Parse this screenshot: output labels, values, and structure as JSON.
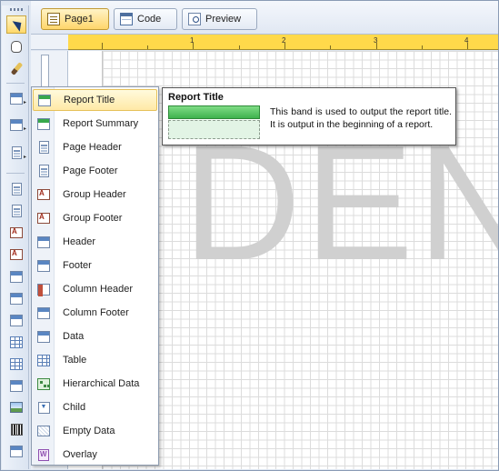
{
  "tabs": [
    {
      "label": "Page1",
      "icon": "page-icon",
      "active": true
    },
    {
      "label": "Code",
      "icon": "code-icon",
      "active": false
    },
    {
      "label": "Preview",
      "icon": "preview-icon",
      "active": false
    }
  ],
  "ruler": {
    "labels": [
      "1",
      "2",
      "3",
      "4"
    ]
  },
  "canvas": {
    "watermark": "DEN"
  },
  "menu": {
    "items": [
      {
        "label": "Report Title",
        "icon": "report-title-band-icon"
      },
      {
        "label": "Report Summary",
        "icon": "report-summary-band-icon"
      },
      {
        "label": "Page Header",
        "icon": "page-header-band-icon"
      },
      {
        "label": "Page Footer",
        "icon": "page-footer-band-icon"
      },
      {
        "label": "Group Header",
        "icon": "group-header-band-icon"
      },
      {
        "label": "Group Footer",
        "icon": "group-footer-band-icon"
      },
      {
        "label": "Header",
        "icon": "header-band-icon"
      },
      {
        "label": "Footer",
        "icon": "footer-band-icon"
      },
      {
        "label": "Column Header",
        "icon": "column-header-band-icon"
      },
      {
        "label": "Column Footer",
        "icon": "column-footer-band-icon"
      },
      {
        "label": "Data",
        "icon": "data-band-icon"
      },
      {
        "label": "Table",
        "icon": "table-band-icon"
      },
      {
        "label": "Hierarchical Data",
        "icon": "hierarchical-data-band-icon"
      },
      {
        "label": "Child",
        "icon": "child-band-icon"
      },
      {
        "label": "Empty Data",
        "icon": "empty-data-band-icon"
      },
      {
        "label": "Overlay",
        "icon": "overlay-band-icon"
      }
    ]
  },
  "tooltip": {
    "title": "Report Title",
    "text": "This band is used to output the report title. It is output in the beginning of a report."
  },
  "colors": {
    "accent": "#ffd94a",
    "tab_active": "#ffd66b",
    "band_green": "#3fb24e"
  }
}
